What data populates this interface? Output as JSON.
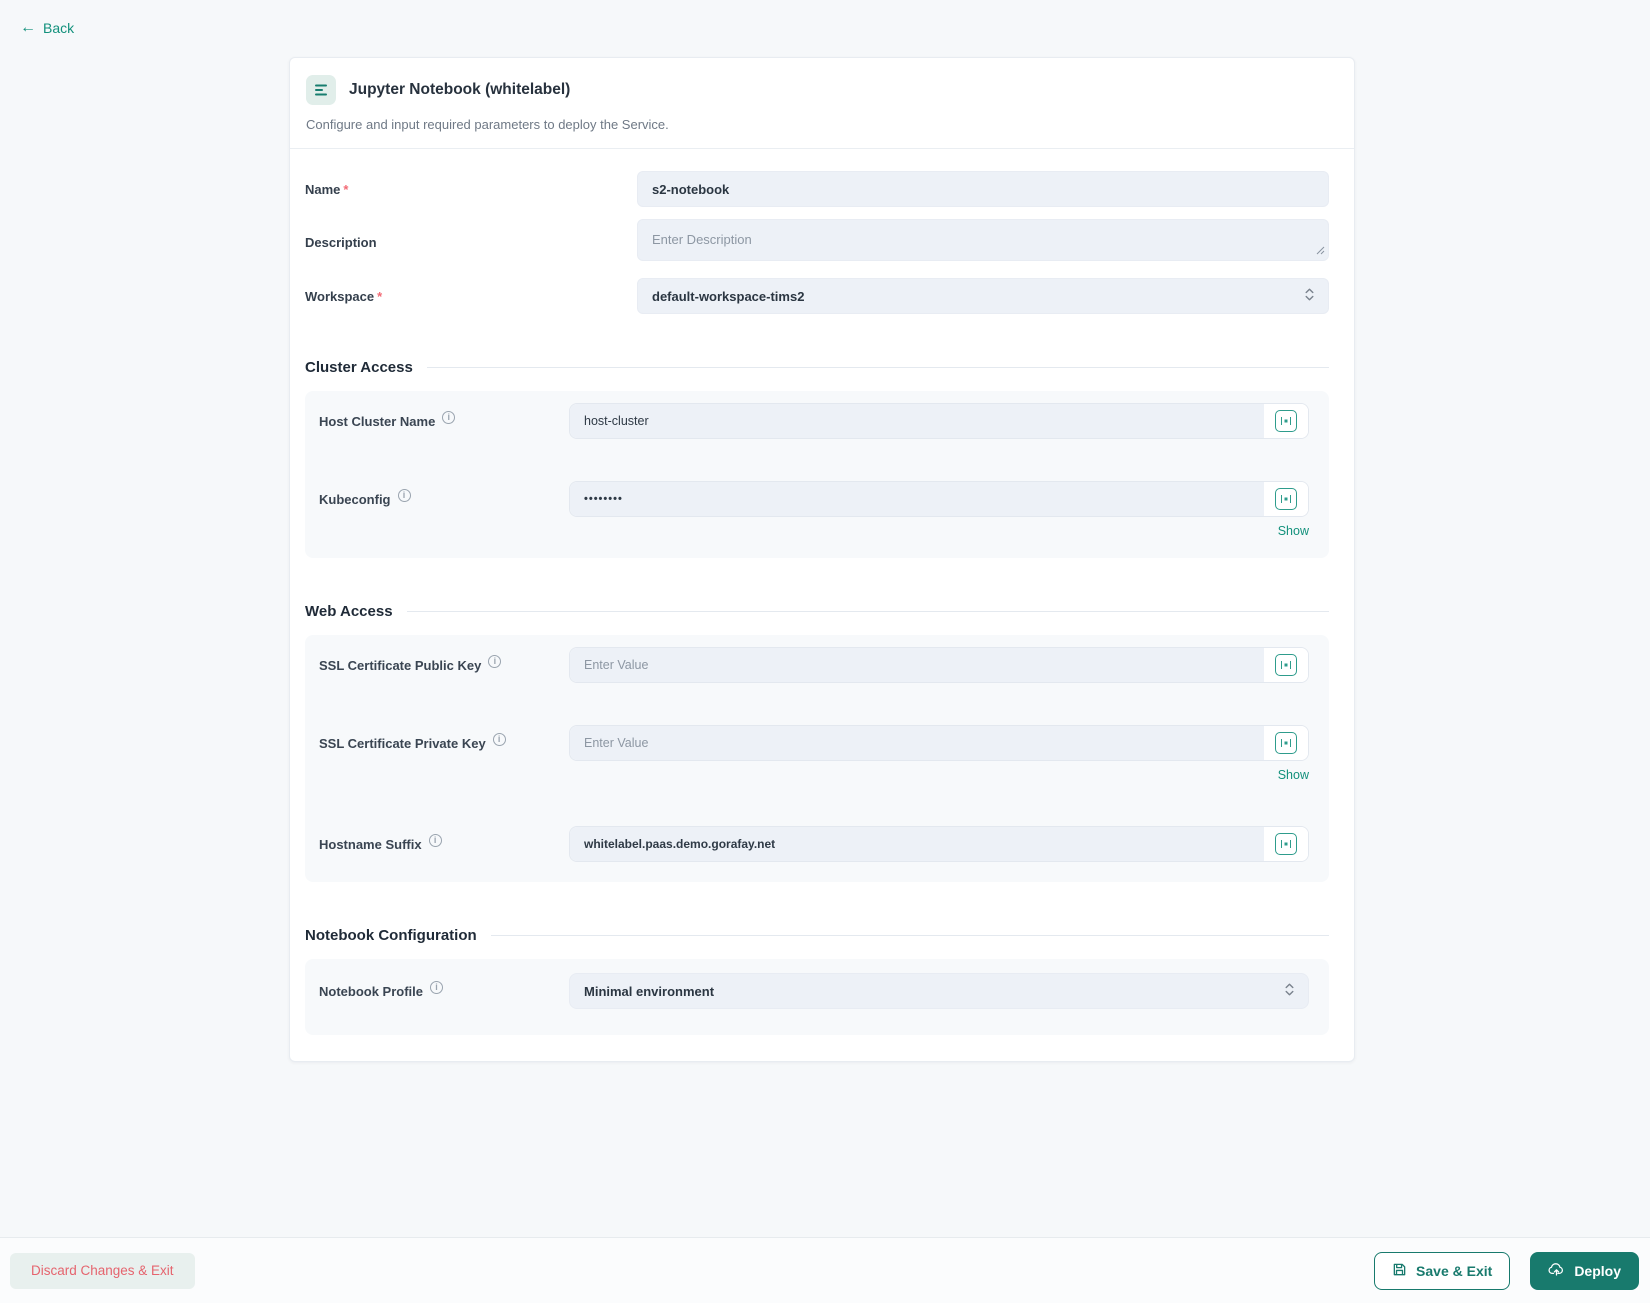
{
  "back": {
    "label": "Back"
  },
  "header": {
    "title": "Jupyter Notebook (whitelabel)",
    "subtitle": "Configure and input required parameters to deploy the Service."
  },
  "required_mark": "*",
  "form": {
    "rows": [
      {
        "label": "Name",
        "required": "*",
        "value": "s2-notebook"
      },
      {
        "label": "Description",
        "placeholder": "Enter Description"
      },
      {
        "label": "Workspace",
        "required": "*",
        "value": "default-workspace-tims2"
      }
    ]
  },
  "sections": [
    {
      "title": "Cluster Access",
      "rows": [
        {
          "label": "Host Cluster Name",
          "value": "host-cluster"
        },
        {
          "label": "Kubeconfig",
          "value": "••••••••",
          "show_label": "Show"
        }
      ]
    },
    {
      "title": "Web Access",
      "rows": [
        {
          "label": "SSL Certificate Public Key",
          "placeholder": "Enter Value"
        },
        {
          "label": "SSL Certificate Private Key",
          "placeholder": "Enter Value",
          "show_label": "Show"
        },
        {
          "label": "Hostname Suffix",
          "value": "whitelabel.paas.demo.gorafay.net"
        }
      ]
    },
    {
      "title": "Notebook Configuration",
      "rows": [
        {
          "label": "Notebook Profile",
          "value": "Minimal environment"
        }
      ]
    }
  ],
  "footer": {
    "discard_label": "Discard Changes & Exit",
    "save_label": "Save & Exit",
    "deploy_label": "Deploy"
  },
  "icons": {
    "back": "arrow-left-icon",
    "service": "service-lines-icon",
    "info": "info-circle-icon",
    "field_action": "expression-square-icon",
    "select": "chevron-up-down-icon",
    "save": "floppy-disk-icon",
    "deploy": "cloud-upload-icon",
    "textarea": "resize-handle-icon"
  },
  "colors": {
    "accent_teal": "#187a6d",
    "link_teal": "#13917c",
    "danger_red": "#e5646e",
    "input_bg": "#edf1f7",
    "page_bg": "#f6f8fa"
  }
}
